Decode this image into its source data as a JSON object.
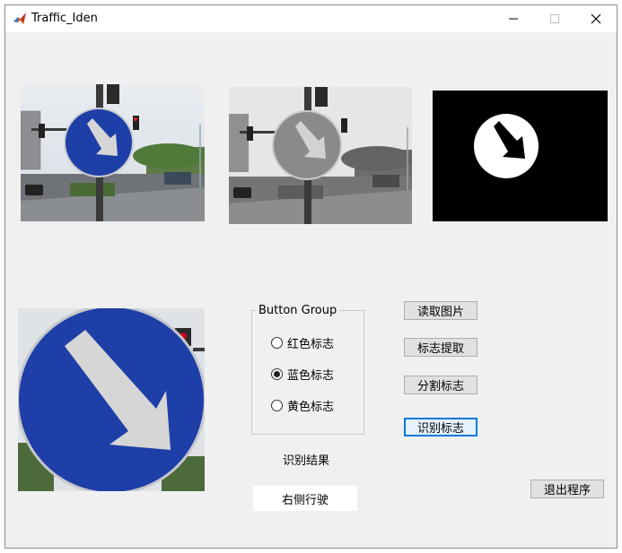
{
  "window": {
    "title": "Traffic_Iden",
    "controls": {
      "minimize": "minimize-icon",
      "maximize": "maximize-icon",
      "close": "close-icon"
    }
  },
  "images": {
    "original": "original-photo",
    "grayscale": "grayscale-photo",
    "binary": "binary-mask",
    "extracted": "extracted-sign"
  },
  "button_group": {
    "title": "Button Group",
    "options": [
      {
        "label": "红色标志",
        "selected": false
      },
      {
        "label": "蓝色标志",
        "selected": true
      },
      {
        "label": "黄色标志",
        "selected": false
      }
    ]
  },
  "buttons": {
    "read_image": "读取图片",
    "extract_sign": "标志提取",
    "segment_sign": "分割标志",
    "recognize_sign": "识别标志",
    "exit": "退出程序"
  },
  "result": {
    "label": "识别结果",
    "value": "右侧行驶"
  },
  "colors": {
    "sign_blue": "#1e3fa8",
    "arrow": "#d6d6d6",
    "focus": "#0078d7"
  }
}
